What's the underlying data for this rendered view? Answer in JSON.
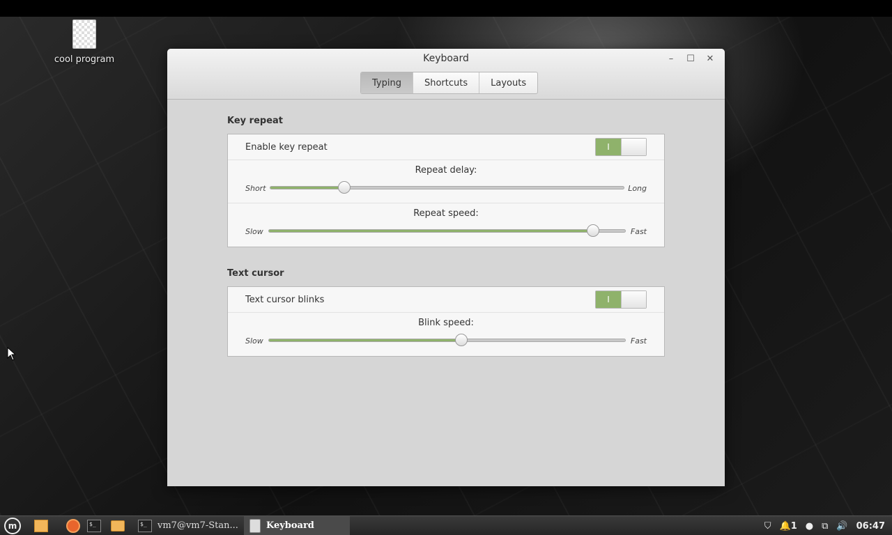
{
  "desktop": {
    "icon_label": "cool program"
  },
  "window": {
    "title": "Keyboard",
    "controls": [
      "minimize-icon",
      "maximize-icon",
      "close-icon"
    ],
    "tabs": [
      {
        "label": "Typing",
        "active": true
      },
      {
        "label": "Shortcuts",
        "active": false
      },
      {
        "label": "Layouts",
        "active": false
      }
    ]
  },
  "key_repeat": {
    "title": "Key repeat",
    "enable_label": "Enable key repeat",
    "enable_on": true,
    "switch_on_glyph": "I",
    "delay": {
      "title": "Repeat delay:",
      "left": "Short",
      "right": "Long",
      "value": 0.21
    },
    "speed": {
      "title": "Repeat speed:",
      "left": "Slow",
      "right": "Fast",
      "value": 0.91
    }
  },
  "text_cursor": {
    "title": "Text cursor",
    "blink_label": "Text cursor blinks",
    "blink_on": true,
    "switch_on_glyph": "I",
    "blink_speed": {
      "title": "Blink speed:",
      "left": "Slow",
      "right": "Fast",
      "value": 0.54
    }
  },
  "taskbar": {
    "windows": [
      {
        "label": "vm7@vm7-Stan...",
        "active": false
      },
      {
        "label": "Keyboard",
        "active": true
      }
    ],
    "notifications": "1",
    "clock": "06:47"
  },
  "colors": {
    "accent": "#8fb26b"
  }
}
